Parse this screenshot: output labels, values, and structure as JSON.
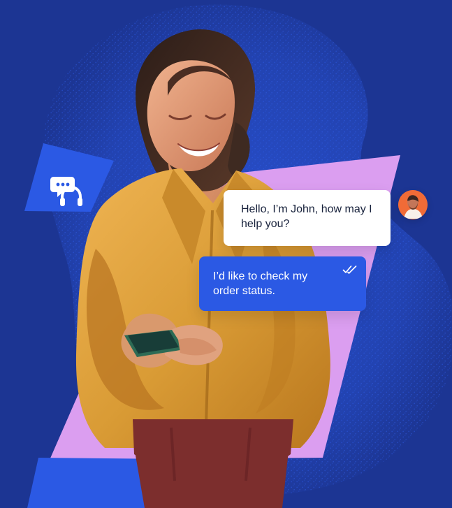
{
  "chat": {
    "agent_message": "Hello, I’m John, how may I help you?",
    "user_message": "I’d like to check my order status."
  },
  "icons": {
    "support": "chat-headset-icon",
    "read": "double-check-icon"
  },
  "colors": {
    "background": "#1c3593",
    "accent_blue": "#2b59e4",
    "accent_pink": "#db9ef0",
    "shirt": "#d99b35",
    "avatar_bg": "#f06b37"
  }
}
